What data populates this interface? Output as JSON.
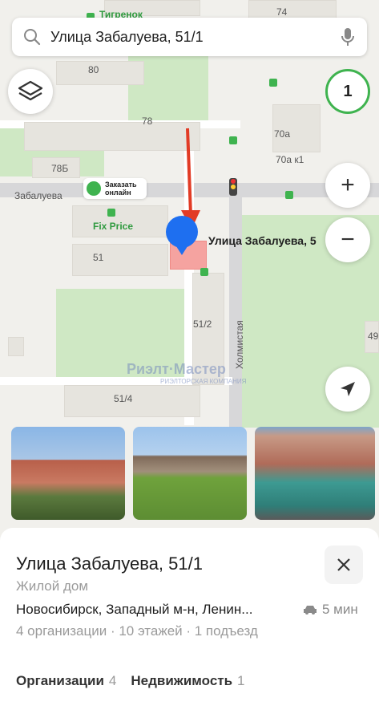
{
  "search": {
    "value": "Улица Забалуева, 51/1"
  },
  "map": {
    "labels": {
      "tigrenok": "Тигренок",
      "b74": "74",
      "b80": "80",
      "b78": "78",
      "b70a": "70а",
      "b70ak1": "70а к1",
      "b78b": "78Б",
      "street_zabalueva": "Забалуева",
      "fix_price": "Fix Price",
      "b51": "51",
      "b51_2": "51/2",
      "b51_4": "51/4",
      "b49": "49",
      "street_holmistaya": "Холмистая"
    },
    "order_chip": "Заказать онлайн",
    "pin_label": "Улица Забалуева, 5",
    "badge_count": "1",
    "watermark": "Риэлт·Мастер",
    "watermark_sub": "РИЭЛТОРСКАЯ КОМПАНИЯ"
  },
  "icons": {
    "search": "search-icon",
    "mic": "microphone-icon",
    "layers": "layers-icon",
    "zoom_in": "plus-icon",
    "zoom_out": "minus-icon",
    "locate": "navigation-arrow-icon",
    "close": "close-icon",
    "car": "car-icon"
  },
  "colors": {
    "accent_green": "#3fb34f",
    "pin_blue": "#1e6ff0",
    "arrow_red": "#e23b25",
    "highlight": "#f5a3a0"
  },
  "place": {
    "title": "Улица Забалуева, 51/1",
    "type": "Жилой дом",
    "address": "Новосибирск, Западный м-н, Ленин...",
    "drive_time": "5 мин",
    "meta": "4 организации · 10 этажей · 1 подъезд",
    "tabs": [
      {
        "label": "Организации",
        "count": "4"
      },
      {
        "label": "Недвижимость",
        "count": "1"
      }
    ]
  }
}
